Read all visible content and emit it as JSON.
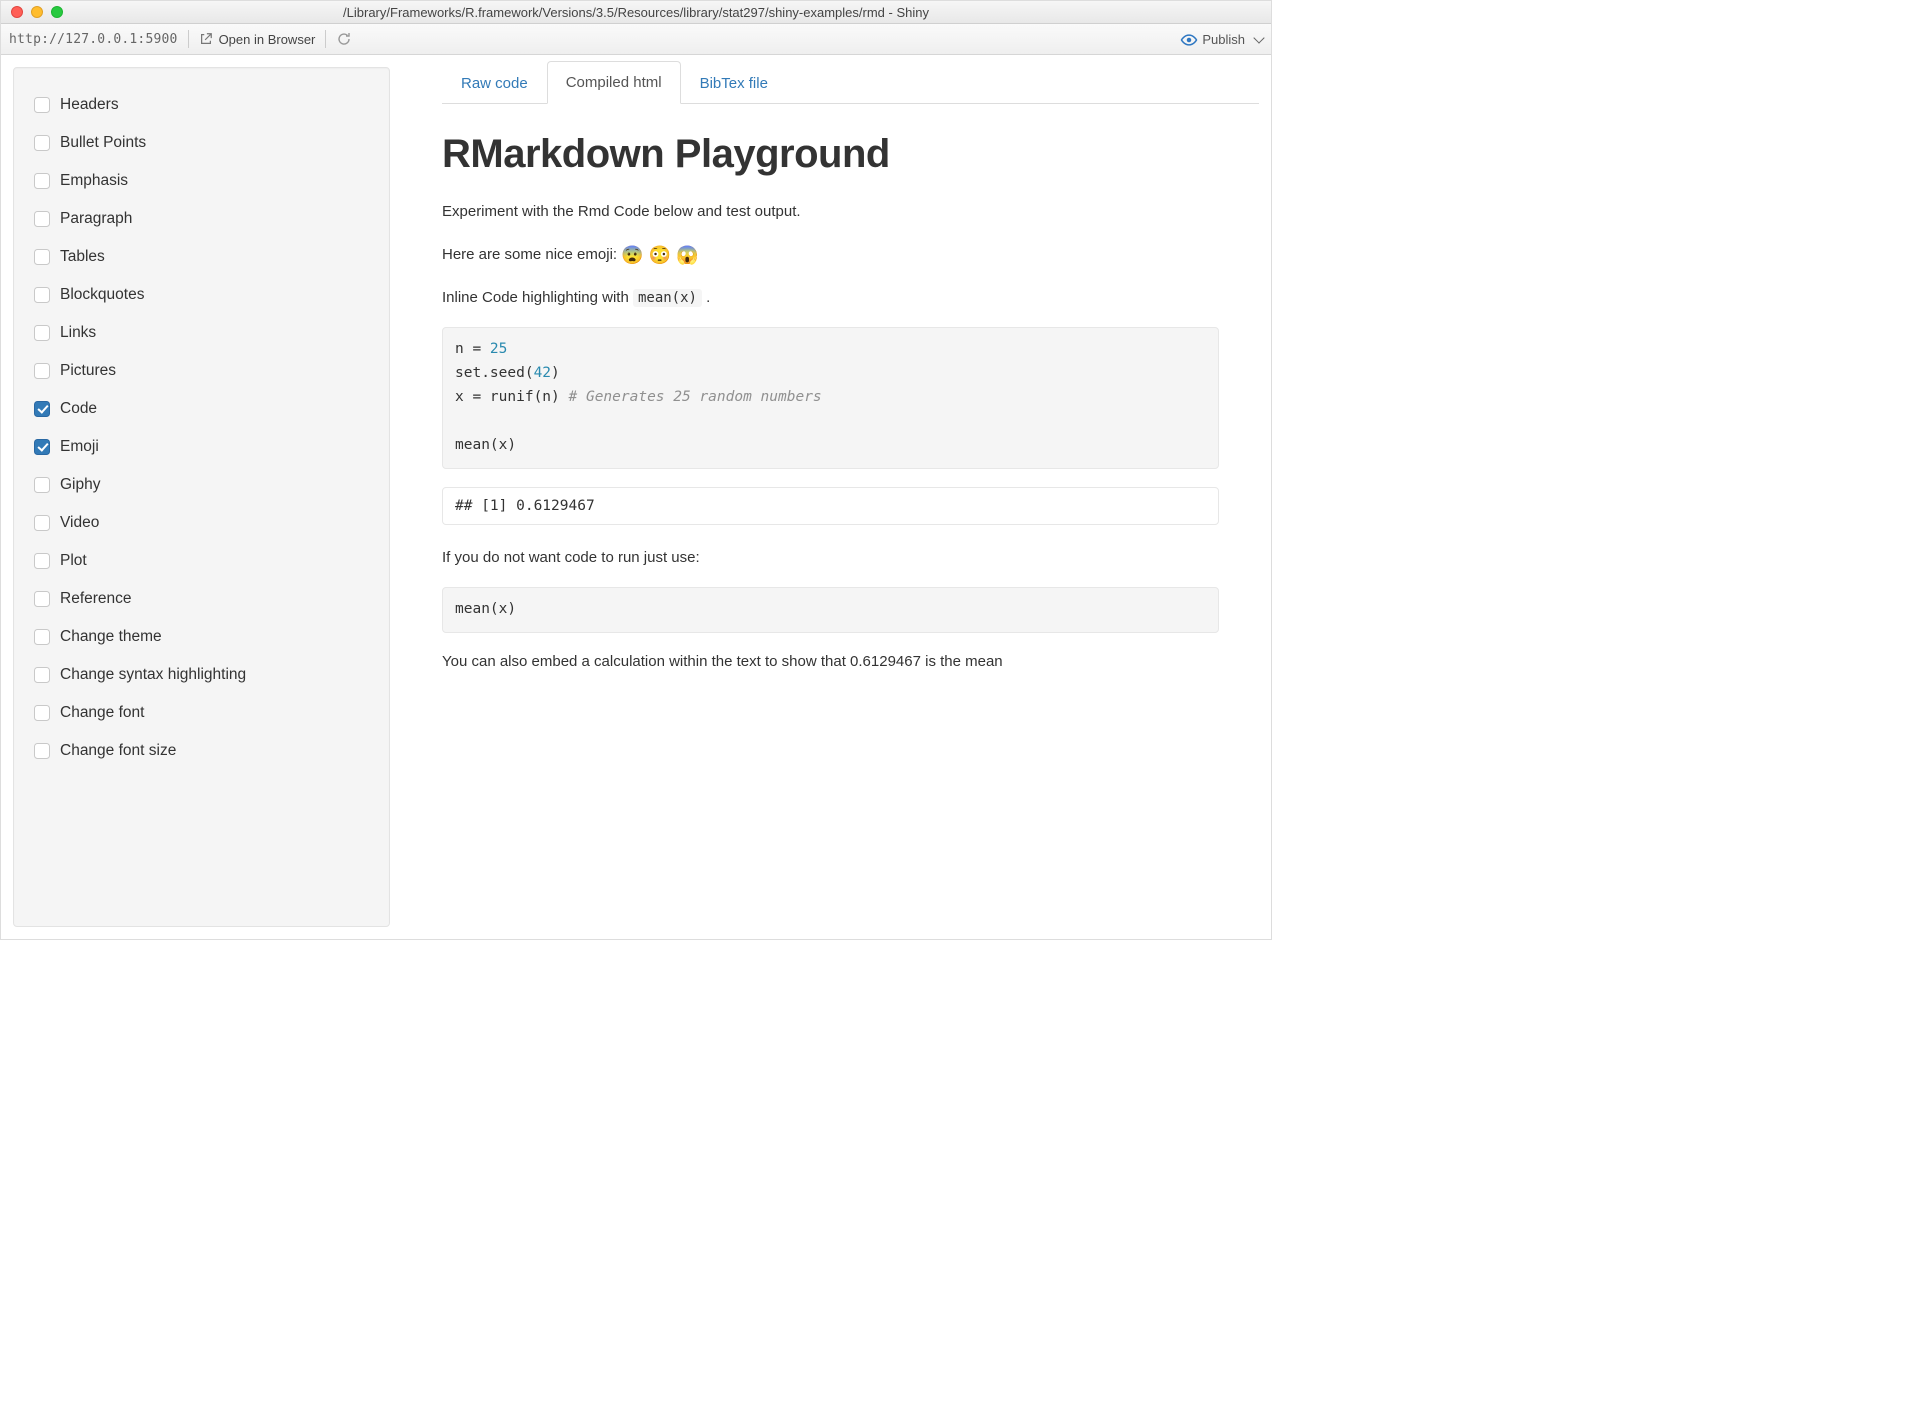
{
  "window": {
    "title": "/Library/Frameworks/R.framework/Versions/3.5/Resources/library/stat297/shiny-examples/rmd - Shiny"
  },
  "toolbar": {
    "url": "http://127.0.0.1:5900",
    "open_label": "Open in Browser",
    "publish_label": "Publish"
  },
  "sidebar": {
    "items": [
      {
        "label": "Headers",
        "checked": false
      },
      {
        "label": "Bullet Points",
        "checked": false
      },
      {
        "label": "Emphasis",
        "checked": false
      },
      {
        "label": "Paragraph",
        "checked": false
      },
      {
        "label": "Tables",
        "checked": false
      },
      {
        "label": "Blockquotes",
        "checked": false
      },
      {
        "label": "Links",
        "checked": false
      },
      {
        "label": "Pictures",
        "checked": false
      },
      {
        "label": "Code",
        "checked": true
      },
      {
        "label": "Emoji",
        "checked": true
      },
      {
        "label": "Giphy",
        "checked": false
      },
      {
        "label": "Video",
        "checked": false
      },
      {
        "label": "Plot",
        "checked": false
      },
      {
        "label": "Reference",
        "checked": false
      },
      {
        "label": "Change theme",
        "checked": false
      },
      {
        "label": "Change syntax highlighting",
        "checked": false
      },
      {
        "label": "Change font",
        "checked": false
      },
      {
        "label": "Change font size",
        "checked": false
      }
    ]
  },
  "tabs": [
    {
      "label": "Raw code",
      "active": false
    },
    {
      "label": "Compiled html",
      "active": true
    },
    {
      "label": "BibTex file",
      "active": false
    }
  ],
  "content": {
    "title": "RMarkdown Playground",
    "p1": "Experiment with the Rmd Code below and test output.",
    "p2_prefix": "Here are some nice emoji: ",
    "emoji": "😨 😳 😱",
    "p3_prefix": "Inline Code highlighting with ",
    "inline_code": "mean(x)",
    "p3_suffix": " .",
    "code_lines": {
      "l1a": "n = ",
      "l1b": "25",
      "l2a": "set.seed(",
      "l2b": "42",
      "l2c": ")",
      "l3a": "x = runif(n) ",
      "l3b": "# Generates 25 random numbers",
      "l4": "",
      "l5": "mean(x)"
    },
    "output": "## [1] 0.6129467",
    "p4": "If you do not want code to run just use:",
    "code2": "mean(x)",
    "p5": "You can also embed a calculation within the text to show that 0.6129467 is the mean"
  }
}
